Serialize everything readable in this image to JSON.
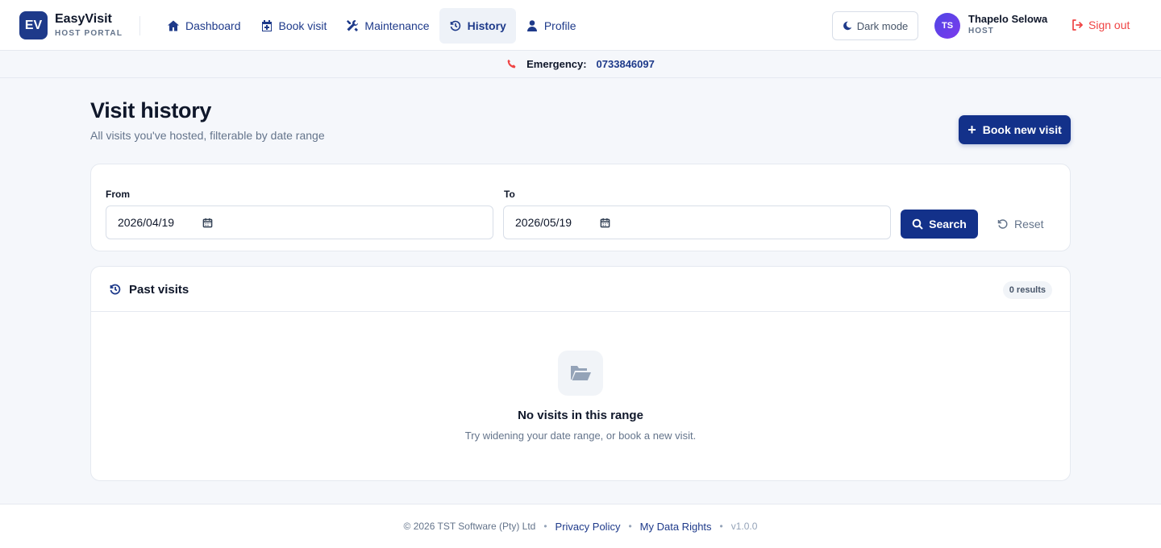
{
  "brand": {
    "badge": "EV",
    "name": "EasyVisit",
    "subtitle": "HOST PORTAL"
  },
  "nav": [
    {
      "label": "Dashboard",
      "icon": "home-icon",
      "active": false
    },
    {
      "label": "Book visit",
      "icon": "calendar-plus-icon",
      "active": false
    },
    {
      "label": "Maintenance",
      "icon": "tools-icon",
      "active": false
    },
    {
      "label": "History",
      "icon": "history-icon",
      "active": true
    },
    {
      "label": "Profile",
      "icon": "user-icon",
      "active": false
    }
  ],
  "header": {
    "dark_mode_label": "Dark mode",
    "user": {
      "initials": "TS",
      "name": "Thapelo Selowa",
      "role": "HOST"
    },
    "sign_out_label": "Sign out"
  },
  "emergency": {
    "label": "Emergency:",
    "number": "0733846097"
  },
  "page": {
    "title": "Visit history",
    "subtitle": "All visits you've hosted, filterable by date range",
    "book_button": "Book new visit"
  },
  "filter": {
    "from_label": "From",
    "from_value": "2026/04/19",
    "to_label": "To",
    "to_value": "2026/05/19",
    "search_button": "Search",
    "reset_button": "Reset"
  },
  "results": {
    "title": "Past visits",
    "count": "0 results",
    "empty_title": "No visits in this range",
    "empty_subtitle": "Try widening your date range, or book a new visit."
  },
  "footer": {
    "copyright": "© 2026 TST Software (Pty) Ltd",
    "privacy": "Privacy Policy",
    "data_rights": "My Data Rights",
    "version": "v1.0.0"
  },
  "colors": {
    "primary": "#13318a",
    "danger": "#ef4444",
    "background": "#f5f7fb"
  }
}
